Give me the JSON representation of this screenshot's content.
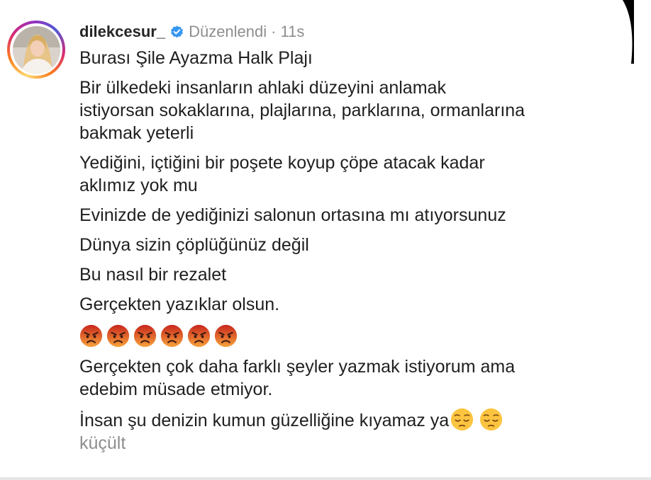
{
  "post": {
    "username": "dilekcesur_",
    "status": "Düzenlendi",
    "separator": "·",
    "time": "11s",
    "verified_icon": "verified-badge-icon",
    "avatar_icon": "profile-photo"
  },
  "caption": {
    "line1": "Burası Şile Ayazma Halk Plajı",
    "line2a": "Bir ülkedeki insanların ahlaki düzeyini anlamak",
    "line2b": "istiyorsan sokaklarına, plajlarına, parklarına, ormanlarına",
    "line2c": "bakmak yeterli",
    "line3a": "Yediğini, içtiğini bir poşete koyup çöpe atacak kadar",
    "line3b": "aklımız yok mu",
    "line4": "Evinizde de yediğinizi salonun ortasına mı atıyorsunuz",
    "line5": "Dünya sizin çöplüğünüz değil",
    "line6": "Bu nasıl bir rezalet",
    "line7": "Gerçekten yazıklar olsun.",
    "angry_emoji_count": 6,
    "line8a": "Gerçekten çok daha farklı şeyler yazmak istiyorum ama",
    "line8b": "edebim müsade etmiyor.",
    "line9": "İnsan şu denizin kumun güzelliğine kıyamaz ya",
    "sad_emoji_count": 2
  },
  "collapse_label": "küçült",
  "colors": {
    "text": "#1f1f1f",
    "muted": "#8e8e8e",
    "verified": "#3897f0",
    "angry_top": "#c8261d",
    "angry_bottom": "#f7a23b",
    "pensive": "#fcc43f"
  }
}
